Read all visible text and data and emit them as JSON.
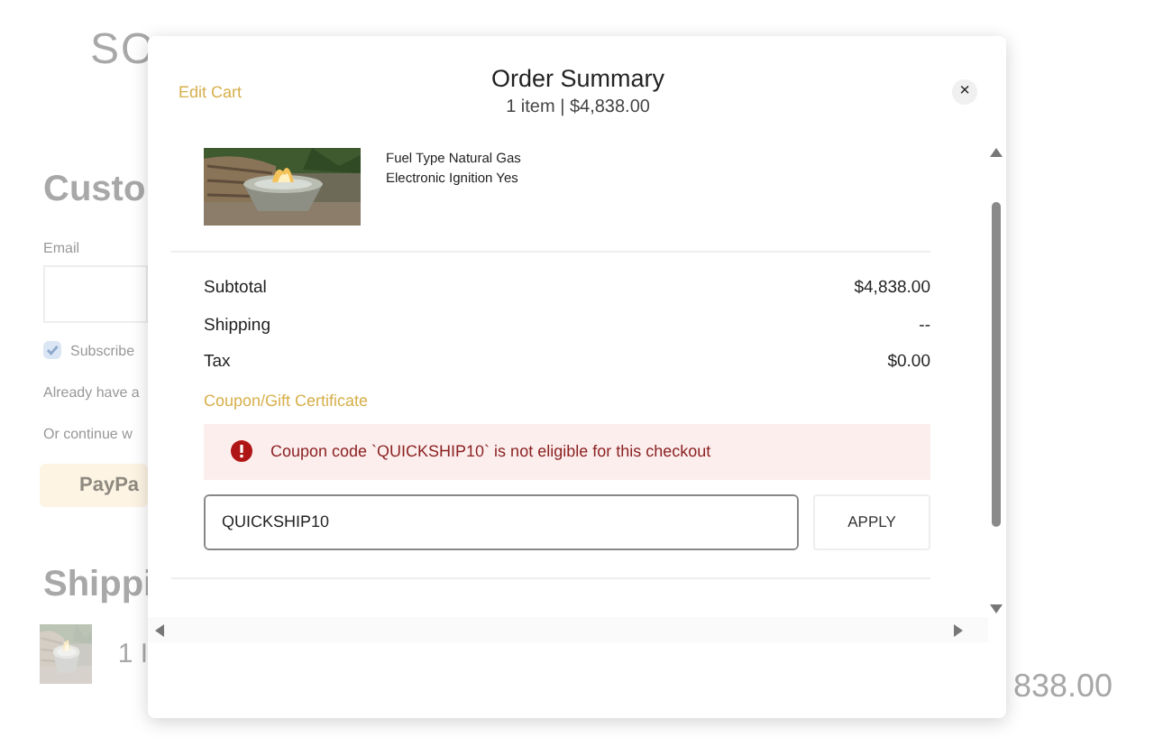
{
  "background": {
    "logo": "SO",
    "heading": "Custo",
    "email_label": "Email",
    "subscribe": {
      "label": "Subscribe",
      "checked": true
    },
    "account_text": "Already have a",
    "continue_text": "Or continue w",
    "paypal": "PayPa",
    "shipping_heading": "Shippi",
    "item_text": "1 I",
    "total": "838.00"
  },
  "modal": {
    "edit_link": "Edit Cart",
    "title": "Order Summary",
    "subtitle": "1 item | $4,838.00",
    "close": "×",
    "product": {
      "details": [
        "Fuel Type Natural Gas",
        "Electronic Ignition Yes"
      ]
    },
    "totals": [
      {
        "label": "Subtotal",
        "value": "$4,838.00"
      },
      {
        "label": "Shipping",
        "value": "--"
      },
      {
        "label": "Tax",
        "value": "$0.00"
      }
    ],
    "coupon_link": "Coupon/Gift Certificate",
    "error": "Coupon code `QUICKSHIP10` is not eligible for this checkout",
    "coupon_field": {
      "value": "QUICKSHIP10"
    },
    "apply_button": "APPLY"
  }
}
